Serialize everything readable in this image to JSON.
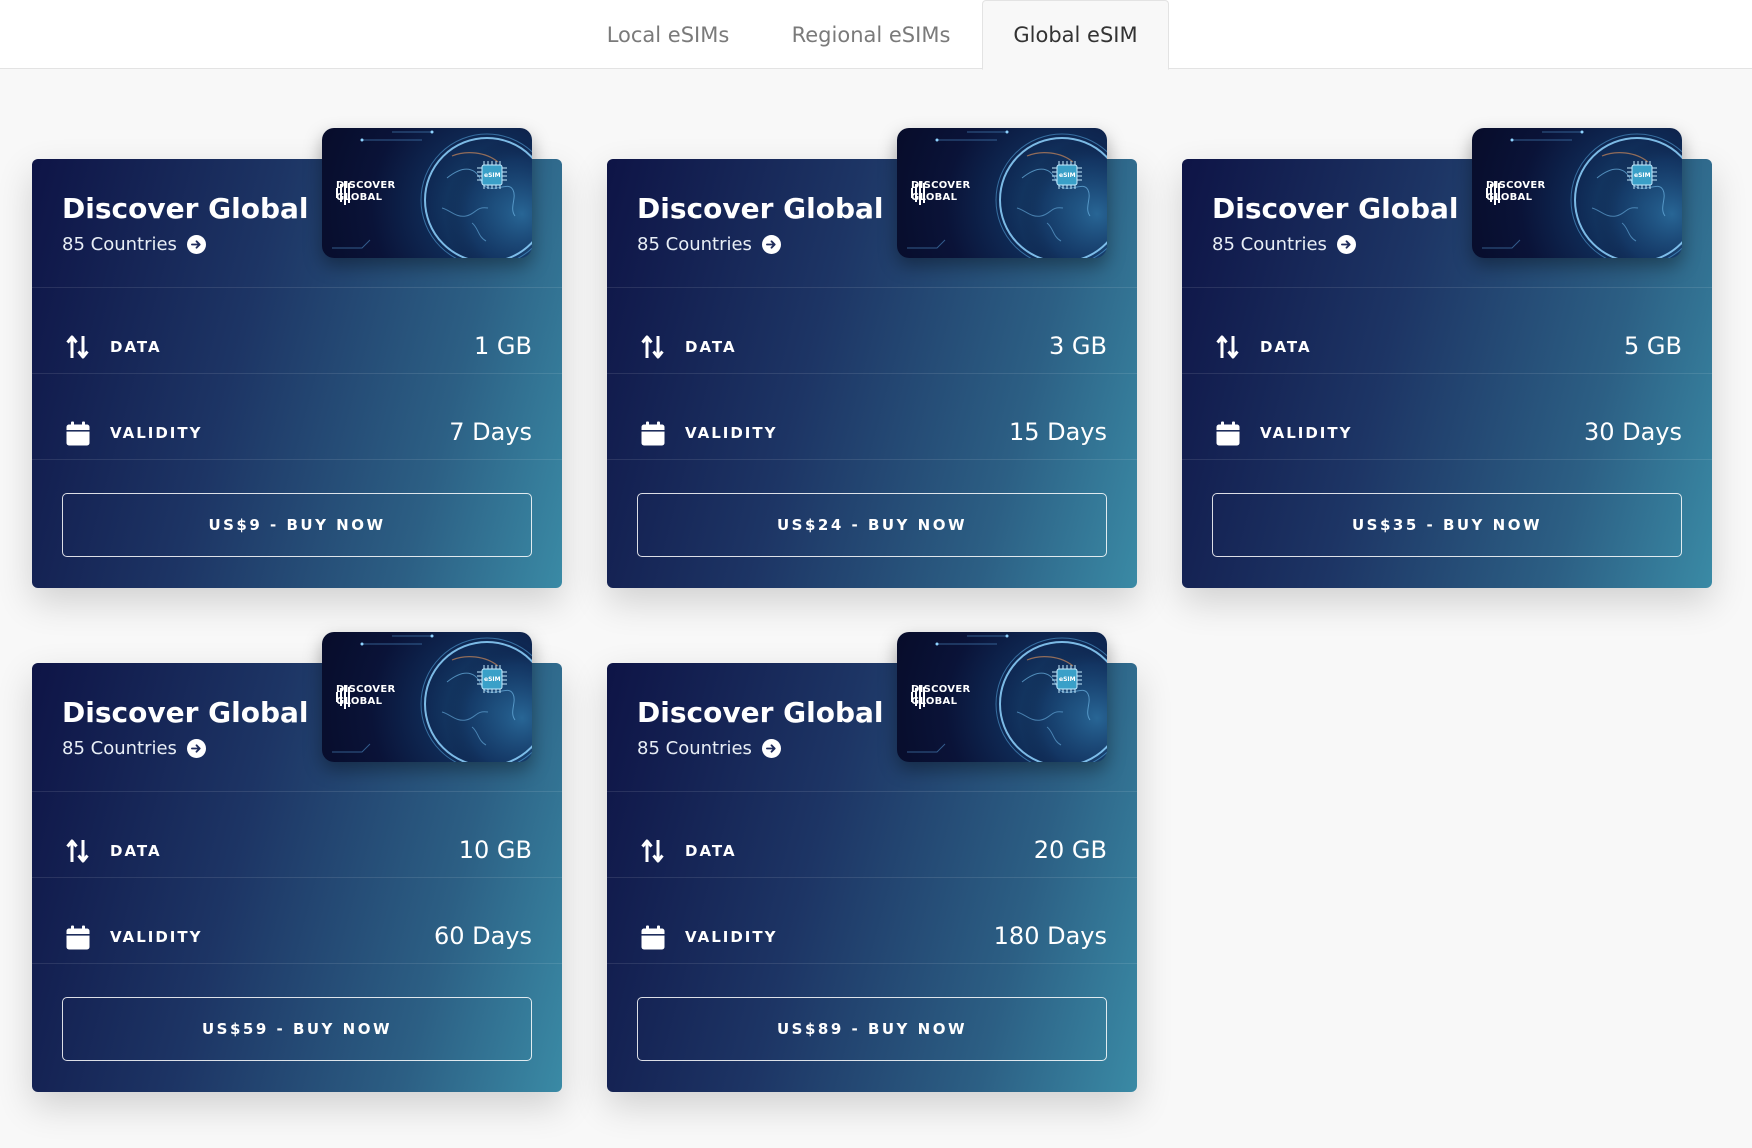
{
  "tabs": [
    {
      "label": "Local eSIMs",
      "active": false
    },
    {
      "label": "Regional eSIMs",
      "active": false
    },
    {
      "label": "Global eSIM",
      "active": true
    }
  ],
  "labels": {
    "data": "DATA",
    "validity": "VALIDITY"
  },
  "sim_card": {
    "logo_line1": "DISCOVER",
    "logo_line2": "GLOBAL",
    "chip_label": "eSIM"
  },
  "plans": [
    {
      "title": "Discover Global",
      "countries": "85 Countries",
      "data": "1 GB",
      "validity": "7 Days",
      "buy": "US$9 - BUY NOW"
    },
    {
      "title": "Discover Global",
      "countries": "85 Countries",
      "data": "3 GB",
      "validity": "15 Days",
      "buy": "US$24 - BUY NOW"
    },
    {
      "title": "Discover Global",
      "countries": "85 Countries",
      "data": "5 GB",
      "validity": "30 Days",
      "buy": "US$35 - BUY NOW"
    },
    {
      "title": "Discover Global",
      "countries": "85 Countries",
      "data": "10 GB",
      "validity": "60 Days",
      "buy": "US$59 - BUY NOW"
    },
    {
      "title": "Discover Global",
      "countries": "85 Countries",
      "data": "20 GB",
      "validity": "180 Days",
      "buy": "US$89 - BUY NOW"
    }
  ],
  "colors": {
    "card_gradient_start": "#0e1446",
    "card_gradient_end": "#3a8aa5",
    "page_background": "#f8f8f8",
    "tab_active_text": "#333333",
    "tab_inactive_text": "#7a7a7a"
  }
}
